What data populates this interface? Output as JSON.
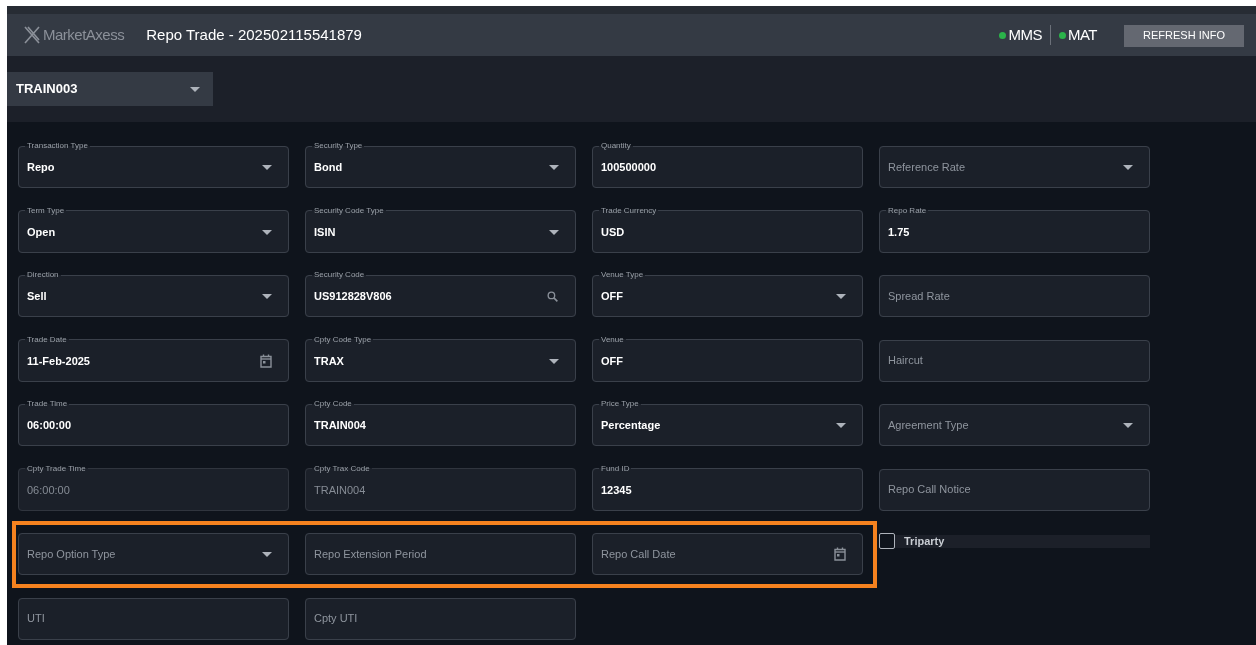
{
  "header": {
    "logo": "MarketAxess",
    "title": "Repo Trade - 202502115541879",
    "status": [
      {
        "label": "MMS",
        "color": "#2bb34a"
      },
      {
        "label": "MAT",
        "color": "#2bb34a"
      }
    ],
    "refresh_button": "REFRESH INFO"
  },
  "account": {
    "value": "TRAIN003"
  },
  "form": {
    "rows": [
      {
        "fields": [
          {
            "kind": "select",
            "label": "Transaction Type",
            "value": "Repo",
            "disabled": false
          },
          {
            "kind": "select",
            "label": "Security Type",
            "value": "Bond",
            "disabled": false
          },
          {
            "kind": "text",
            "label": "Quantity",
            "value": "100500000",
            "disabled": false
          },
          {
            "kind": "select",
            "placeholder": "Reference Rate"
          }
        ]
      },
      {
        "fields": [
          {
            "kind": "select",
            "label": "Term Type",
            "value": "Open",
            "disabled": false
          },
          {
            "kind": "select",
            "label": "Security Code Type",
            "value": "ISIN",
            "disabled": false
          },
          {
            "kind": "text",
            "label": "Trade Currency",
            "value": "USD",
            "disabled": false
          },
          {
            "kind": "text",
            "label": "Repo Rate",
            "value": "1.75",
            "disabled": false
          }
        ]
      },
      {
        "fields": [
          {
            "kind": "select",
            "label": "Direction",
            "value": "Sell",
            "disabled": false
          },
          {
            "kind": "search",
            "label": "Security Code",
            "value": "US912828V806",
            "disabled": false
          },
          {
            "kind": "select",
            "label": "Venue Type",
            "value": "OFF",
            "disabled": false
          },
          {
            "kind": "text",
            "placeholder": "Spread Rate"
          }
        ]
      },
      {
        "fields": [
          {
            "kind": "date",
            "label": "Trade Date",
            "value": "11-Feb-2025",
            "disabled": false
          },
          {
            "kind": "select",
            "label": "Cpty Code Type",
            "value": "TRAX",
            "disabled": false
          },
          {
            "kind": "text",
            "label": "Venue",
            "value": "OFF",
            "disabled": false
          },
          {
            "kind": "text",
            "placeholder": "Haircut"
          }
        ]
      },
      {
        "fields": [
          {
            "kind": "text",
            "label": "Trade Time",
            "value": "06:00:00",
            "disabled": false
          },
          {
            "kind": "text",
            "label": "Cpty Code",
            "value": "TRAIN004",
            "disabled": false
          },
          {
            "kind": "select",
            "label": "Price Type",
            "value": "Percentage",
            "disabled": false
          },
          {
            "kind": "select",
            "placeholder": "Agreement Type"
          }
        ]
      },
      {
        "fields": [
          {
            "kind": "text",
            "label": "Cpty Trade Time",
            "value": "06:00:00",
            "disabled": true
          },
          {
            "kind": "text",
            "label": "Cpty Trax Code",
            "value": "TRAIN004",
            "disabled": true
          },
          {
            "kind": "text",
            "label": "Fund ID",
            "value": "12345",
            "disabled": false
          },
          {
            "kind": "text",
            "placeholder": "Repo Call Notice"
          }
        ]
      },
      {
        "highlighted": true,
        "fields": [
          {
            "kind": "select",
            "placeholder": "Repo Option Type"
          },
          {
            "kind": "text",
            "placeholder": "Repo Extension Period"
          },
          {
            "kind": "date",
            "placeholder": "Repo Call Date"
          },
          {
            "kind": "checkbox",
            "label": "Triparty",
            "checked": false
          }
        ]
      },
      {
        "fields": [
          {
            "kind": "text",
            "placeholder": "UTI"
          },
          {
            "kind": "text",
            "placeholder": "Cpty UTI"
          }
        ]
      }
    ]
  }
}
